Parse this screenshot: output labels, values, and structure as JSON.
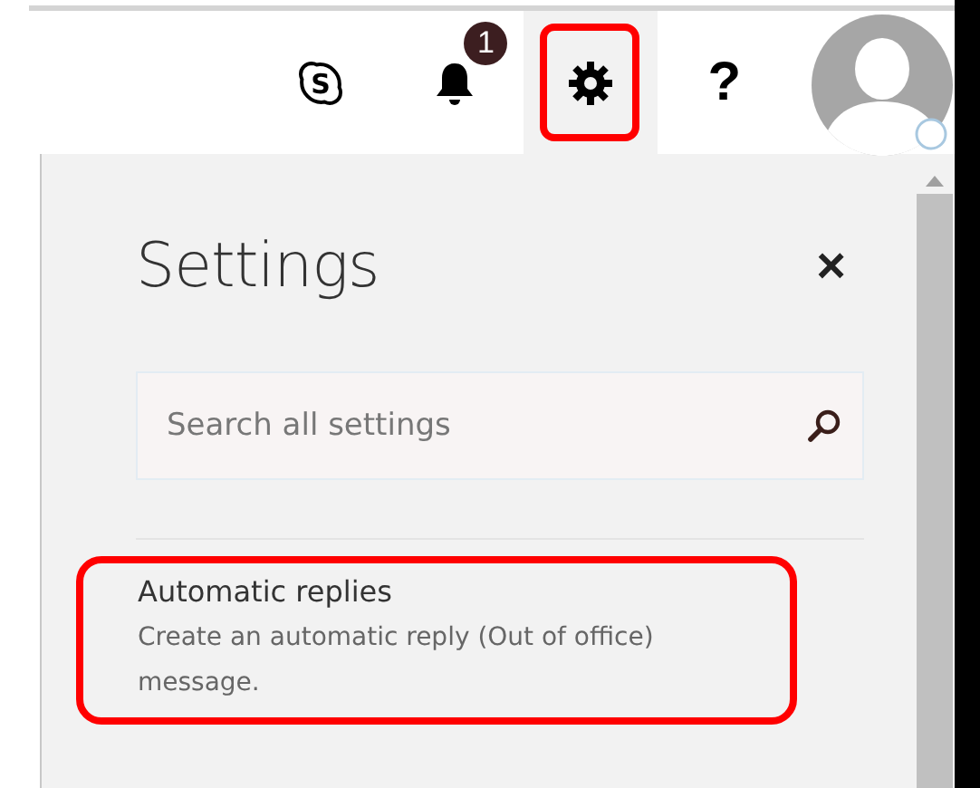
{
  "header": {
    "notification_count": "1",
    "buttons": [
      {
        "kind": "skype",
        "highlighted": false,
        "selected": false
      },
      {
        "kind": "bell",
        "highlighted": false,
        "selected": false
      },
      {
        "kind": "gear",
        "highlighted": true,
        "selected": true
      },
      {
        "kind": "help",
        "highlighted": false,
        "selected": false
      }
    ],
    "help_label": "?",
    "skype_label": "S"
  },
  "settings": {
    "title": "Settings",
    "close": "×",
    "search": {
      "placeholder": "Search all settings"
    },
    "items": [
      {
        "title": "Automatic replies",
        "description": "Create an automatic reply (Out of office) message.",
        "highlighted": true
      }
    ]
  }
}
